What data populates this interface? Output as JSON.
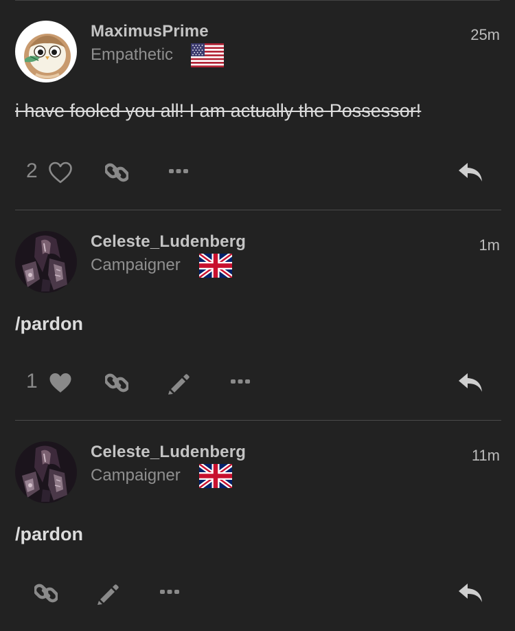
{
  "posts": [
    {
      "username": "MaximusPrime",
      "title": "Empathetic",
      "flag": "us-flag",
      "time": "25m",
      "body": "i have fooled you all! I am actually the Possessor!",
      "likes": "2",
      "liked": false,
      "avatar": "owl-avatar"
    },
    {
      "username": "Celeste_Ludenberg",
      "title": "Campaigner",
      "flag": "uk-flag",
      "time": "1m",
      "body": "/pardon",
      "likes": "1",
      "liked": true,
      "avatar": "dark-portrait-avatar"
    },
    {
      "username": "Celeste_Ludenberg",
      "title": "Campaigner",
      "flag": "uk-flag",
      "time": "11m",
      "body": "/pardon",
      "likes": "",
      "liked": false,
      "avatar": "dark-portrait-avatar"
    }
  ],
  "colors": {
    "background": "#222222",
    "username": "#c4c4c4",
    "meta": "#8f8f8f",
    "icon": "#8a8a8a",
    "reply_icon": "#cfcfcf"
  }
}
